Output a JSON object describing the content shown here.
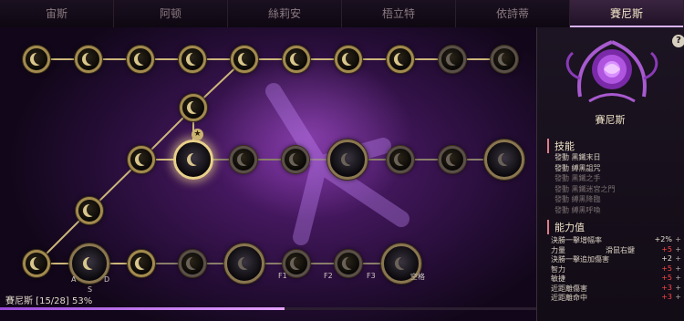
{
  "tabs": [
    "宙斯",
    "阿顿",
    "絲莉安",
    "梧立特",
    "依詩蒂",
    "賽尼斯"
  ],
  "active_tab": 5,
  "tree": {
    "selected_star": "★",
    "keys": {
      "a": "A",
      "d": "D",
      "s": "S",
      "f1": "F1",
      "f2": "F2",
      "f3": "F3",
      "space": "空格"
    },
    "progress_label": "賽尼斯 [15/28] 53%",
    "progress_fraction": 0.53
  },
  "panel": {
    "help": "?",
    "class_name": "賽尼斯",
    "skills_title": "技能",
    "skills": [
      {
        "text": "發動 黑鐵末日",
        "active": true
      },
      {
        "text": "發動 縛黑詛咒",
        "active": true
      },
      {
        "text": "發動 黑鐵之手",
        "active": false
      },
      {
        "text": "發動 黑鐵迷宮之門",
        "active": false
      },
      {
        "text": "發動 縛黑降臨",
        "active": false
      },
      {
        "text": "發動 縛黑呼喚",
        "active": false
      }
    ],
    "stats_title": "能力值",
    "stats": [
      {
        "name": "決勝一擊增幅率",
        "sub": "",
        "value": "+2%",
        "color": "wht",
        "plus": "+"
      },
      {
        "name": "力量",
        "sub": "滑鼠右鍵",
        "value": "+5",
        "color": "red",
        "plus": "+"
      },
      {
        "name": "決勝一擊追加傷害",
        "sub": "",
        "value": "+2",
        "color": "wht",
        "plus": "+"
      },
      {
        "name": "智力",
        "sub": "",
        "value": "+5",
        "color": "red",
        "plus": "+"
      },
      {
        "name": "敏捷",
        "sub": "",
        "value": "+5",
        "color": "red",
        "plus": "+"
      },
      {
        "name": "近距離傷害",
        "sub": "",
        "value": "+3",
        "color": "red",
        "plus": "+"
      },
      {
        "name": "近距離命中",
        "sub": "",
        "value": "+3",
        "color": "red",
        "plus": "+"
      }
    ]
  },
  "colors": {
    "accent": "#d8b2ff",
    "node_gold": "#a38a4e",
    "stat_red": "#ff4848"
  }
}
